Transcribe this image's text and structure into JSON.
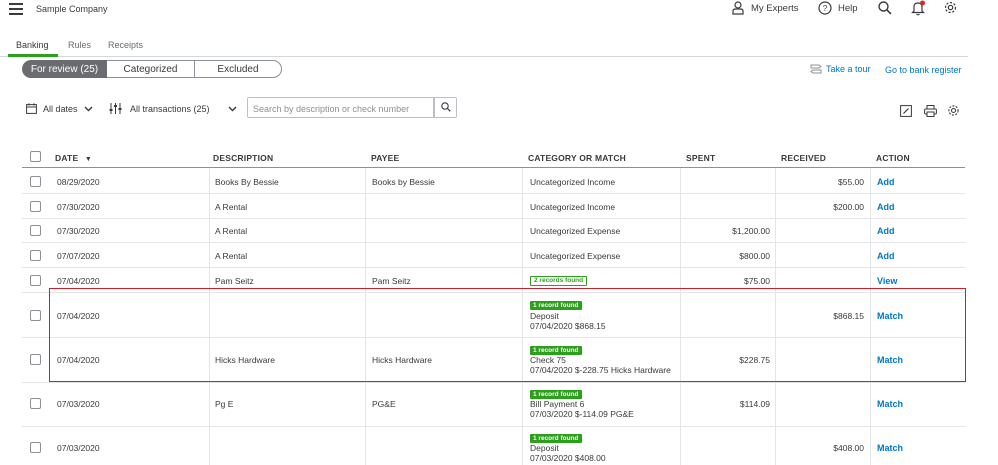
{
  "header": {
    "company": "Sample Company",
    "my_experts": "My Experts",
    "help": "Help",
    "notification_color": "#d52b1e"
  },
  "tabs": [
    {
      "label": "Banking",
      "active": true
    },
    {
      "label": "Rules",
      "active": false
    },
    {
      "label": "Receipts",
      "active": false
    }
  ],
  "segments": {
    "for_review": "For review (25)",
    "categorized": "Categorized",
    "excluded": "Excluded"
  },
  "links": {
    "take_tour": "Take a tour",
    "bank_register": "Go to bank register"
  },
  "filters": {
    "dates": "All dates",
    "transactions": "All transactions (25)",
    "search_placeholder": "Search by description or check number"
  },
  "table": {
    "columns": {
      "date": "DATE",
      "description": "DESCRIPTION",
      "payee": "PAYEE",
      "category": "CATEGORY OR MATCH",
      "spent": "SPENT",
      "received": "RECEIVED",
      "action": "ACTION"
    },
    "rows": [
      {
        "date": "08/29/2020",
        "description": "Books By Bessie",
        "payee": "Books by Bessie",
        "category": "Uncategorized Income",
        "spent": "",
        "received": "$55.00",
        "action": "Add"
      },
      {
        "date": "07/30/2020",
        "description": "A Rental",
        "payee": "",
        "category": "Uncategorized Income",
        "spent": "",
        "received": "$200.00",
        "action": "Add"
      },
      {
        "date": "07/30/2020",
        "description": "A Rental",
        "payee": "",
        "category": "Uncategorized Expense",
        "spent": "$1,200.00",
        "received": "",
        "action": "Add"
      },
      {
        "date": "07/07/2020",
        "description": "A Rental",
        "payee": "",
        "category": "Uncategorized Expense",
        "spent": "$800.00",
        "received": "",
        "action": "Add"
      },
      {
        "date": "07/04/2020",
        "description": "Pam Seitz",
        "payee": "Pam Seitz",
        "badge": "2 records found",
        "spent": "$75.00",
        "received": "",
        "action": "View"
      },
      {
        "date": "07/04/2020",
        "description": "",
        "payee": "",
        "badge": "1 record found",
        "match_title": "Deposit",
        "match_detail": "07/04/2020 $868.15",
        "spent": "",
        "received": "$868.15",
        "action": "Match"
      },
      {
        "date": "07/04/2020",
        "description": "Hicks Hardware",
        "payee": "Hicks Hardware",
        "badge": "1 record found",
        "match_title": "Check 75",
        "match_detail": "07/04/2020 $-228.75 Hicks Hardware",
        "spent": "$228.75",
        "received": "",
        "action": "Match"
      },
      {
        "date": "07/03/2020",
        "description": "Pg E",
        "payee": "PG&E",
        "badge": "1 record found",
        "match_title": "Bill Payment 6",
        "match_detail": "07/03/2020 $-114.09 PG&E",
        "spent": "$114.09",
        "received": "",
        "action": "Match"
      },
      {
        "date": "07/03/2020",
        "description": "",
        "payee": "",
        "badge": "1 record found",
        "match_title": "Deposit",
        "match_detail": "07/03/2020 $408.00",
        "spent": "",
        "received": "$408.00",
        "action": "Match"
      }
    ]
  }
}
